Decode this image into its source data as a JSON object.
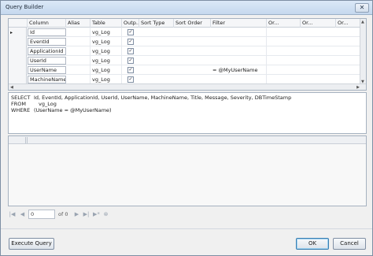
{
  "window": {
    "title": "Query Builder",
    "close_glyph": "✕"
  },
  "grid": {
    "columns": [
      "Column",
      "Alias",
      "Table",
      "Outp...",
      "Sort Type",
      "Sort Order",
      "Filter",
      "Or...",
      "Or...",
      "Or..."
    ],
    "rows": [
      {
        "column": "Id",
        "alias": "",
        "table": "vg_Log",
        "output": true,
        "filter": "",
        "selected": true
      },
      {
        "column": "EventId",
        "alias": "",
        "table": "vg_Log",
        "output": true,
        "filter": "",
        "selected": false
      },
      {
        "column": "ApplicationId",
        "alias": "",
        "table": "vg_Log",
        "output": true,
        "filter": "",
        "selected": false
      },
      {
        "column": "UserId",
        "alias": "",
        "table": "vg_Log",
        "output": true,
        "filter": "",
        "selected": false
      },
      {
        "column": "UserName",
        "alias": "",
        "table": "vg_Log",
        "output": true,
        "filter": "= @MyUserName",
        "selected": false
      },
      {
        "column": "MachineName",
        "alias": "",
        "table": "vg_Log",
        "output": true,
        "filter": "",
        "selected": false
      }
    ],
    "row_marker": "▸",
    "check_glyph": "✓"
  },
  "sql": {
    "lines": [
      {
        "keyword": "SELECT",
        "text": "Id, EventId, ApplicationId, UserId, UserName, MachineName, Title, Message, Severity, DBTimeStamp"
      },
      {
        "keyword": "FROM",
        "text": "vg_Log"
      },
      {
        "keyword": "WHERE",
        "text": "(UserName = @MyUserName)"
      }
    ]
  },
  "navigator": {
    "first": "|◀",
    "prev": "◀",
    "page_value": "0",
    "of_label": "of 0",
    "next": "▶",
    "last": "▶|",
    "new": "▶*",
    "delete": "⊗"
  },
  "buttons": {
    "execute_query": "Execute Query",
    "ok": "OK",
    "cancel": "Cancel"
  }
}
